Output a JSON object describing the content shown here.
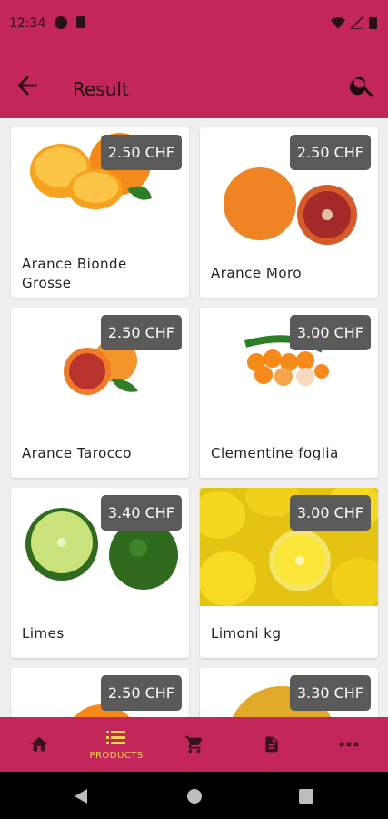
{
  "status_bar": {
    "time": "12:34"
  },
  "app_bar": {
    "title": "Result"
  },
  "products": [
    {
      "name": "Arance Bionde Grosse",
      "price": "2.50 CHF"
    },
    {
      "name": "Arance Moro",
      "price": "2.50 CHF"
    },
    {
      "name": "Arance Tarocco",
      "price": "2.50 CHF"
    },
    {
      "name": "Clementine foglia",
      "price": "3.00 CHF"
    },
    {
      "name": "Limes",
      "price": "3.40 CHF"
    },
    {
      "name": "Limoni kg",
      "price": "3.00 CHF"
    },
    {
      "name": "",
      "price": "2.50 CHF"
    },
    {
      "name": "",
      "price": "3.30 CHF"
    }
  ],
  "bottom_nav": {
    "items": [
      {
        "icon": "home-icon",
        "label": ""
      },
      {
        "icon": "list-icon",
        "label": "PRODUCTS"
      },
      {
        "icon": "cart-icon",
        "label": ""
      },
      {
        "icon": "document-icon",
        "label": ""
      },
      {
        "icon": "more-icon",
        "label": ""
      }
    ]
  },
  "colors": {
    "primary": "#c2265a",
    "active": "#f3d54a",
    "price_badge": "#5a5a5a"
  }
}
